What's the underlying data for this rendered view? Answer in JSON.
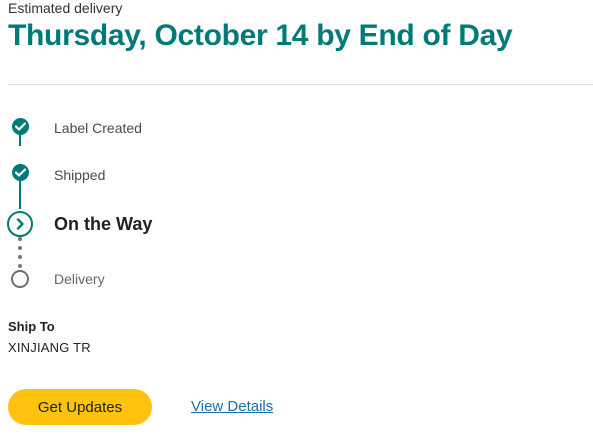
{
  "header": {
    "estimate_label": "Estimated delivery",
    "estimate_date": "Thursday, October 14 by End of Day"
  },
  "progress": {
    "steps": [
      {
        "label": "Label Created",
        "status": "complete",
        "icon": "check-icon"
      },
      {
        "label": "Shipped",
        "status": "complete",
        "icon": "check-icon"
      },
      {
        "label": "On the Way",
        "status": "current",
        "icon": "chevron-right-icon"
      },
      {
        "label": "Delivery",
        "status": "pending",
        "icon": "empty-circle-icon"
      }
    ]
  },
  "ship_to": {
    "title": "Ship To",
    "location": "XINJIANG TR"
  },
  "actions": {
    "updates_label": "Get Updates",
    "details_label": "View Details"
  },
  "colors": {
    "accent": "#007a78",
    "button": "#ffc20e",
    "link": "#1a6fa8",
    "pending": "#6f6f6f"
  }
}
